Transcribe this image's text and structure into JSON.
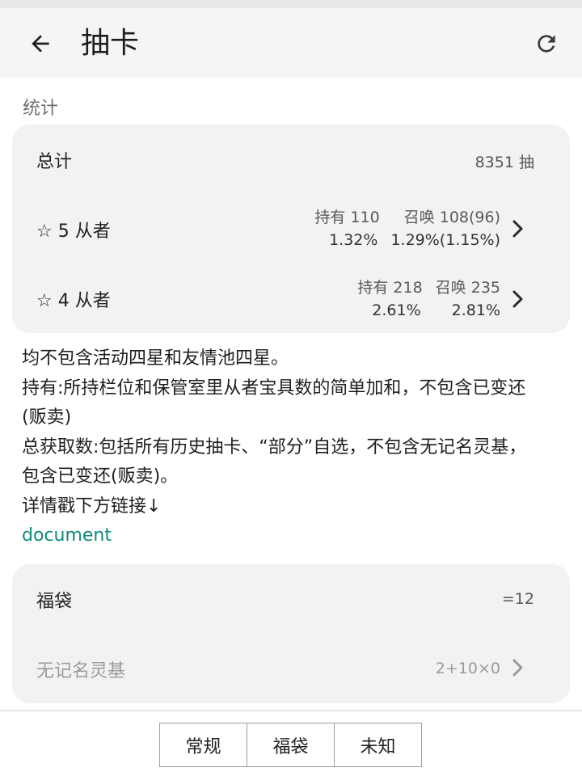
{
  "header": {
    "title": "抽卡",
    "back_icon": "arrow-left-icon",
    "refresh_icon": "refresh-icon"
  },
  "stats": {
    "section_label": "统计",
    "total": {
      "label": "总计",
      "value": "8351 抽"
    },
    "five_star": {
      "label": "☆ 5 从者",
      "owned_label": "持有 110",
      "summon_label": "召唤 108(96)",
      "owned_rate": "1.32%",
      "summon_rate": "1.29%(1.15%)"
    },
    "four_star": {
      "label": "☆ 4 从者",
      "owned_label": "持有 218",
      "summon_label": "召唤 235",
      "owned_rate": "2.61%",
      "summon_rate": "2.81%"
    }
  },
  "notes": {
    "line1": "均不包含活动四星和友情池四星。",
    "line2": "持有:所持栏位和保管室里从者宝具数的简单加和，不包含已变还",
    "line3": "(贩卖)",
    "line4": "总获取数:包括所有历史抽卡、“部分”自选，不包含无记名灵基，",
    "line5": "包含已变还(贩卖)。",
    "line6": "详情戳下方链接↓",
    "link": "document"
  },
  "lucky_bag": {
    "label": "福袋",
    "value": "=12",
    "unregistered_label": "无记名灵基",
    "unregistered_value": "2+10×0"
  },
  "bottom_tabs": [
    "常规",
    "福袋",
    "未知"
  ],
  "colors": {
    "link": "#0f8a7c",
    "card_bg": "#f2f2f2",
    "app_bar_bg": "#f5f5f5"
  }
}
